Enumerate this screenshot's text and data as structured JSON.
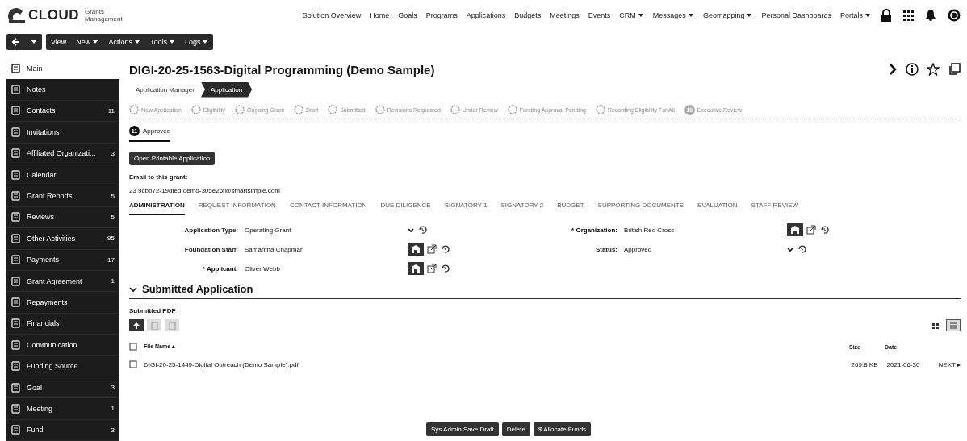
{
  "header": {
    "logo": {
      "brand": "CLOUD",
      "tagline": "Grants Management"
    },
    "nav": [
      {
        "label": "Solution Overview",
        "dropdown": false
      },
      {
        "label": "Home",
        "dropdown": false
      },
      {
        "label": "Goals",
        "dropdown": false
      },
      {
        "label": "Programs",
        "dropdown": false
      },
      {
        "label": "Applications",
        "dropdown": false
      },
      {
        "label": "Budgets",
        "dropdown": false
      },
      {
        "label": "Meetings",
        "dropdown": false
      },
      {
        "label": "Events",
        "dropdown": false
      },
      {
        "label": "CRM",
        "dropdown": true
      },
      {
        "label": "Messages",
        "dropdown": true
      },
      {
        "label": "Geomapping",
        "dropdown": true
      },
      {
        "label": "Personal Dashboards",
        "dropdown": false
      },
      {
        "label": "Portals",
        "dropdown": true
      }
    ]
  },
  "toolbar": {
    "menus": [
      {
        "label": "View",
        "dropdown": false
      },
      {
        "label": "New",
        "dropdown": true
      },
      {
        "label": "Actions",
        "dropdown": true
      },
      {
        "label": "Tools",
        "dropdown": true
      },
      {
        "label": "Logs",
        "dropdown": true
      }
    ]
  },
  "sidebar": {
    "items": [
      {
        "label": "Main",
        "selected": true
      },
      {
        "label": "Notes",
        "selected": false
      },
      {
        "label": "Contacts",
        "count": "11",
        "selected": false
      },
      {
        "label": "Invitations",
        "selected": false
      },
      {
        "label": "Affiliated Organizati...",
        "count": "3",
        "selected": false
      },
      {
        "label": "Calendar",
        "selected": false
      },
      {
        "label": "Grant Reports",
        "count": "5",
        "selected": false
      },
      {
        "label": "Reviews",
        "count": "5",
        "selected": false
      },
      {
        "label": "Other Activities",
        "count": "95",
        "selected": false
      },
      {
        "label": "Payments",
        "count": "17",
        "selected": false
      },
      {
        "label": "Grant Agreement",
        "count": "1",
        "selected": false
      },
      {
        "label": "Repayments",
        "selected": false
      },
      {
        "label": "Financials",
        "selected": false
      },
      {
        "label": "Communication",
        "selected": false
      },
      {
        "label": "Funding Source",
        "selected": false
      },
      {
        "label": "Goal",
        "count": "3",
        "selected": false
      },
      {
        "label": "Meeting",
        "count": "1",
        "selected": false
      },
      {
        "label": "Fund",
        "count": "3",
        "selected": false
      }
    ]
  },
  "record": {
    "title": "DIGI-20-25-1563-Digital Programming (Demo Sample)",
    "breadcrumb": [
      {
        "label": "Application Manager",
        "selected": false
      },
      {
        "label": "Application",
        "selected": true
      }
    ],
    "steps": [
      {
        "label": "New Application",
        "selected": false
      },
      {
        "label": "Eligibility",
        "selected": false
      },
      {
        "label": "Ongoing Grant",
        "selected": false
      },
      {
        "label": "Draft",
        "selected": false
      },
      {
        "label": "Submitted",
        "selected": false
      },
      {
        "label": "Revisions Requested",
        "selected": false
      },
      {
        "label": "Under Review",
        "selected": false
      },
      {
        "label": "Funding Approval Pending",
        "selected": false
      },
      {
        "label": "Recording Eligibility For All",
        "selected": false
      },
      {
        "label": "Executive Review",
        "number": "10",
        "selected": false
      },
      {
        "label": "Approved",
        "number": "11",
        "selected": true
      }
    ],
    "print_button": "Open Printable Application",
    "email_label": "Email to this grant:",
    "email": "23 9cbb72-19dfed demo-305e26f@smartsimple.com",
    "tabs": [
      {
        "label": "ADMINISTRATION",
        "selected": true
      },
      {
        "label": "REQUEST INFORMATION",
        "selected": false
      },
      {
        "label": "CONTACT INFORMATION",
        "selected": false
      },
      {
        "label": "DUE DILIGENCE",
        "selected": false
      },
      {
        "label": "SIGNATORY 1",
        "selected": false
      },
      {
        "label": "SIGNATORY 2",
        "selected": false
      },
      {
        "label": "BUDGET",
        "selected": false
      },
      {
        "label": "SUPPORTING DOCUMENTS",
        "selected": false
      },
      {
        "label": "EVALUATION",
        "selected": false
      },
      {
        "label": "STAFF REVIEW",
        "selected": false
      }
    ],
    "fields_left": [
      {
        "label": "Application Type:",
        "value": "Operating Grant",
        "required": false,
        "kind": "select"
      },
      {
        "label": "Foundation Staff:",
        "value": "Samantha Chapman",
        "required": false,
        "kind": "lookup"
      },
      {
        "label": "* Applicant:",
        "value": "Oliver Webb",
        "required": true,
        "kind": "lookup"
      }
    ],
    "fields_right": [
      {
        "label": "* Organization:",
        "value": "British Red Cross",
        "required": true,
        "kind": "lookup"
      },
      {
        "label": "Status:",
        "value": "Approved",
        "required": false,
        "kind": "select"
      }
    ],
    "section": {
      "title": "Submitted Application",
      "expanded": true
    },
    "pdf_label": "Submitted PDF",
    "columns": [
      {
        "label": "File Name ▴"
      },
      {
        "label": "Size"
      },
      {
        "label": "Date"
      }
    ],
    "files": [
      {
        "name": "DIGI-20-25-1449-Digital Outreach (Demo Sample).pdf",
        "size": "269.8 KB",
        "date": "2021-06-30",
        "checked": false
      }
    ],
    "pager": "NEXT ▸",
    "actions": [
      "Sys Admin Save Draft",
      "Delete",
      "$ Allocate Funds"
    ]
  }
}
